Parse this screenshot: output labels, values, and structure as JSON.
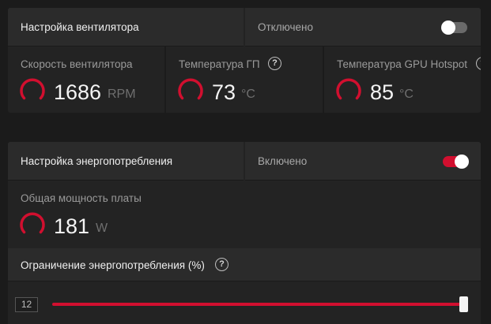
{
  "fan": {
    "title": "Настройка вентилятора",
    "status": "Отключено",
    "toggle_on": false,
    "metrics": [
      {
        "label": "Скорость вентилятора",
        "value": "1686",
        "unit": "RPM"
      },
      {
        "label": "Температура ГП",
        "value": "73",
        "unit": "°C",
        "help": "?"
      },
      {
        "label": "Температура GPU Hotspot",
        "value": "85",
        "unit": "°C"
      }
    ]
  },
  "power": {
    "title": "Настройка энергопотребления",
    "status": "Включено",
    "toggle_on": true,
    "board_power": {
      "label": "Общая мощность платы",
      "value": "181",
      "unit": "W"
    },
    "limit": {
      "label": "Ограничение энергопотребления (%)",
      "help": "?",
      "value": "12",
      "slider_fraction": 1.0
    }
  },
  "colors": {
    "accent": "#d10f2f",
    "panel": "#232323",
    "header": "#2b2b2b"
  }
}
